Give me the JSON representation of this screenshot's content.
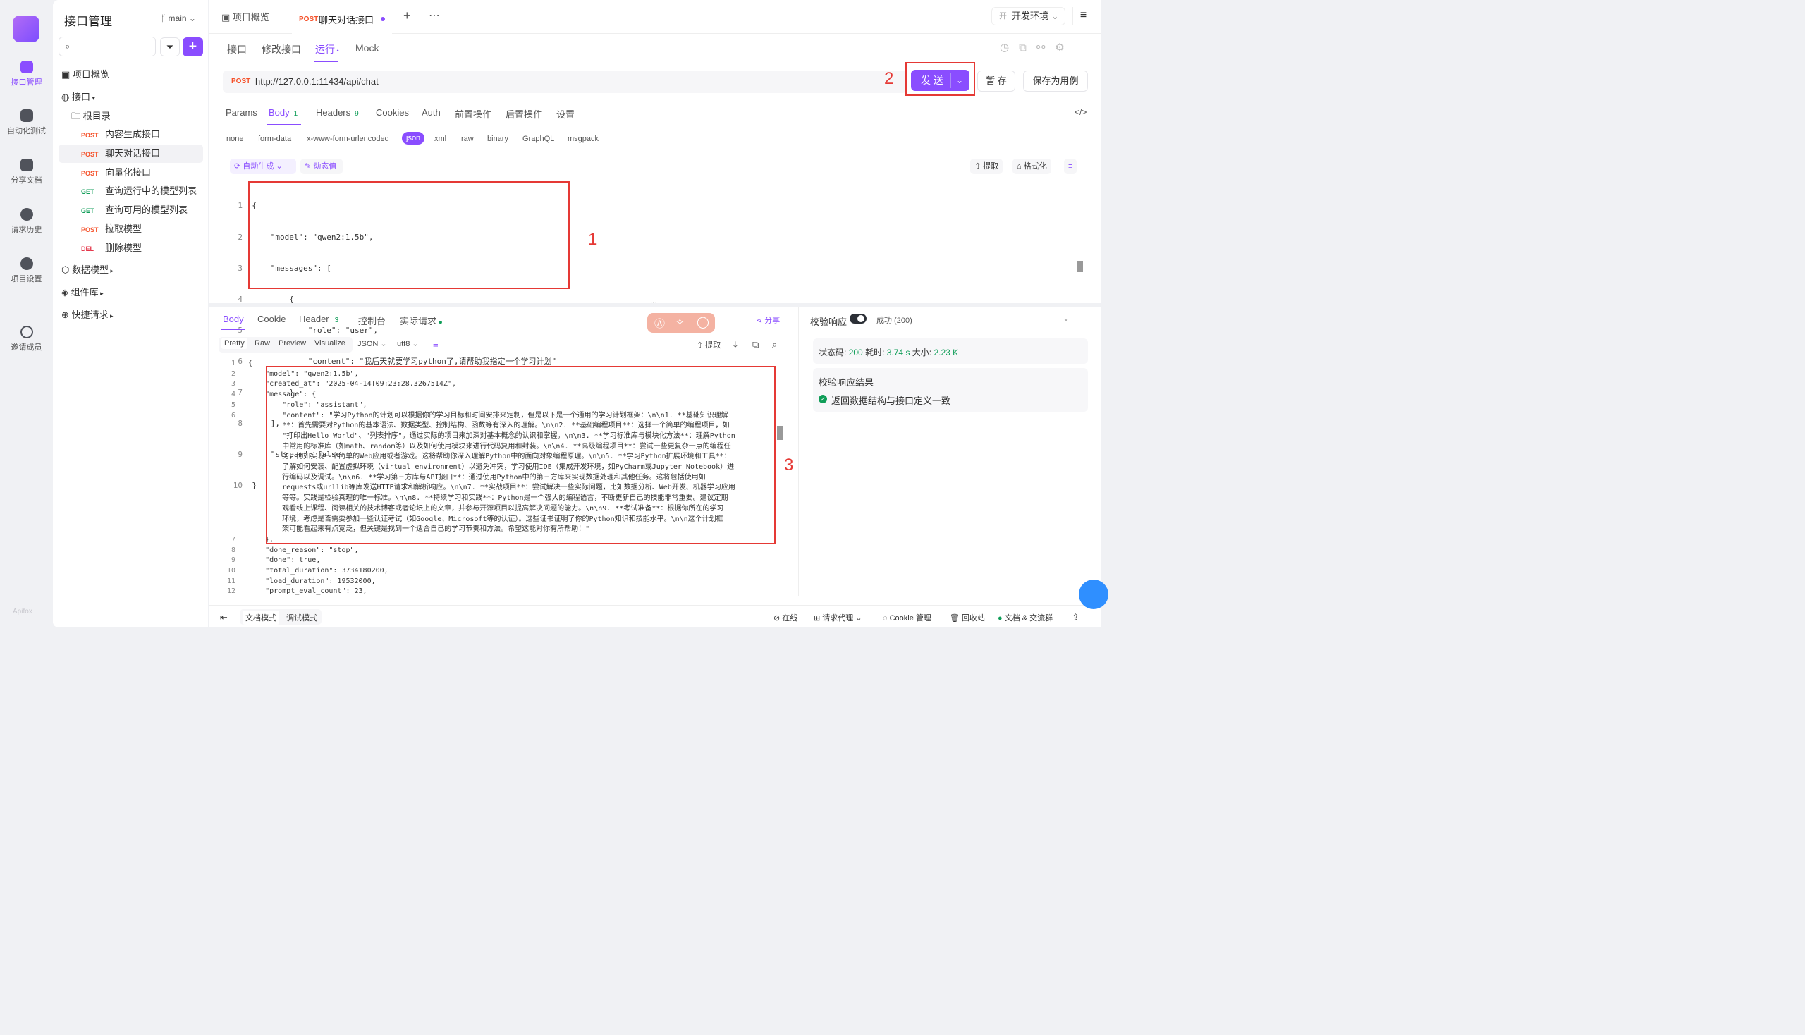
{
  "rail": {
    "items": [
      {
        "label": "接口管理",
        "icon": "api-icon"
      },
      {
        "label": "自动化测试",
        "icon": "automation-icon"
      },
      {
        "label": "分享文档",
        "icon": "book-icon"
      },
      {
        "label": "请求历史",
        "icon": "clock-icon"
      },
      {
        "label": "项目设置",
        "icon": "gear-icon"
      },
      {
        "label": "邀请成员",
        "icon": "invite-user-icon"
      }
    ],
    "brand": "Apifox"
  },
  "tree": {
    "title": "接口管理",
    "branch": "main",
    "overview": "项目概览",
    "api_group": "接口",
    "root": "根目录",
    "endpoints": [
      {
        "method": "POST",
        "name": "内容生成接口"
      },
      {
        "method": "POST",
        "name": "聊天对话接口"
      },
      {
        "method": "POST",
        "name": "向量化接口"
      },
      {
        "method": "GET",
        "name": "查询运行中的模型列表"
      },
      {
        "method": "GET",
        "name": "查询可用的模型列表"
      },
      {
        "method": "POST",
        "name": "拉取模型"
      },
      {
        "method": "DEL",
        "name": "删除模型"
      }
    ],
    "groups": [
      "数据模型",
      "组件库",
      "快捷请求"
    ]
  },
  "tabs": {
    "overview": "项目概览",
    "active_method": "POST",
    "active": "聊天对话接口",
    "env": "开发环境",
    "env_badge": "开"
  },
  "subtabs": [
    "接口",
    "修改接口",
    "运行",
    "Mock"
  ],
  "request": {
    "method": "POST",
    "url": "http://127.0.0.1:11434/api/chat",
    "send": "发 送",
    "save": "暂 存",
    "save_case": "保存为用例"
  },
  "param_tabs": {
    "items": [
      "Params",
      "Body",
      "Headers",
      "Cookies",
      "Auth",
      "前置操作",
      "后置操作",
      "设置"
    ],
    "body_count": "1",
    "headers_count": "9"
  },
  "body_types": [
    "none",
    "form-data",
    "x-www-form-urlencoded",
    "json",
    "xml",
    "raw",
    "binary",
    "GraphQL",
    "msgpack"
  ],
  "body_tools": {
    "auto": "自动生成",
    "dynamic": "动态值",
    "extract": "提取",
    "format": "格式化"
  },
  "body_code": [
    "{",
    "    \"model\": \"qwen2:1.5b\",",
    "    \"messages\": [",
    "        {",
    "            \"role\": \"user\",",
    "            \"content\": \"我后天就要学习python了,请帮助我指定一个学习计划\"",
    "        }",
    "    ],",
    "    \"stream\": false",
    "}"
  ],
  "labels": {
    "one": "1",
    "two": "2",
    "three": "3"
  },
  "response": {
    "tabs": [
      "Body",
      "Cookie",
      "Header",
      "控制台",
      "实际请求"
    ],
    "header_count": "3",
    "share": "分享",
    "formats": [
      "Pretty",
      "Raw",
      "Preview",
      "Visualize"
    ],
    "lang": "JSON",
    "encoding": "utf8",
    "extract": "提取",
    "lines": [
      {
        "n": "1",
        "t": "{"
      },
      {
        "n": "2",
        "t": "    \"model\": \"qwen2:1.5b\","
      },
      {
        "n": "3",
        "t": "    \"created_at\": \"2025-04-14T09:23:28.3267514Z\","
      },
      {
        "n": "4",
        "t": "    \"message\": {"
      },
      {
        "n": "5",
        "t": "        \"role\": \"assistant\","
      },
      {
        "n": "6",
        "t": "        \"content\": \"学习Python的计划可以根据你的学习目标和时间安排来定制，但是以下是一个通用的学习计划框架：\\n\\n1. **基础知识理解"
      },
      {
        "n": "",
        "t": "        **：首先需要对Python的基本语法、数据类型、控制结构、函数等有深入的理解。\\n\\n2. **基础编程项目**：选择一个简单的编程项目，如"
      },
      {
        "n": "",
        "t": "        \"打印出Hello World\"、\"列表排序\"。通过实际的项目来加深对基本概念的认识和掌握。\\n\\n3. **学习标准库与模块化方法**：理解Python"
      },
      {
        "n": "",
        "t": "        中常用的标准库（如math、random等）以及如何使用模块来进行代码复用和封装。\\n\\n4. **高级编程项目**：尝试一些更复杂一点的编程任"
      },
      {
        "n": "",
        "t": "        务，比如实现一个简单的Web应用或者游戏。这将帮助你深入理解Python中的面向对象编程原理。\\n\\n5. **学习Python扩展环境和工具**："
      },
      {
        "n": "",
        "t": "        了解如何安装、配置虚拟环境（virtual environment）以避免冲突，学习使用IDE（集成开发环境，如PyCharm或Jupyter Notebook）进"
      },
      {
        "n": "",
        "t": "        行编码以及调试。\\n\\n6. **学习第三方库与API接口**：通过使用Python中的第三方库来实现数据处理和其他任务。这将包括使用如"
      },
      {
        "n": "",
        "t": "        requests或urllib等库发送HTTP请求和解析响应。\\n\\n7. **实战项目**：尝试解决一些实际问题，比如数据分析、Web开发、机器学习应用"
      },
      {
        "n": "",
        "t": "        等等。实践是检验真理的唯一标准。\\n\\n8. **持续学习和实践**：Python是一个强大的编程语言，不断更新自己的技能非常重要。建议定期"
      },
      {
        "n": "",
        "t": "        观看线上课程、阅读相关的技术博客或者论坛上的文章，并参与开源项目以提高解决问题的能力。\\n\\n9. **考试准备**：根据你所在的学习"
      },
      {
        "n": "",
        "t": "        环境，考虑是否需要参加一些认证考试（如Google、Microsoft等的认证）。这些证书证明了你的Python知识和技能水平。\\n\\n这个计划框"
      },
      {
        "n": "",
        "t": "        架可能看起来有点宽泛，但关键是找到一个适合自己的学习节奏和方法。希望这能对你有所帮助！\""
      },
      {
        "n": "7",
        "t": "    },"
      },
      {
        "n": "8",
        "t": "    \"done_reason\": \"stop\","
      },
      {
        "n": "9",
        "t": "    \"done\": true,"
      },
      {
        "n": "10",
        "t": "    \"total_duration\": 3734180200,"
      },
      {
        "n": "11",
        "t": "    \"load_duration\": 19532000,"
      },
      {
        "n": "12",
        "t": "    \"prompt_eval_count\": 23,"
      }
    ]
  },
  "validate": {
    "label": "校验响应",
    "result": "成功 (200)",
    "status_label": "状态码:",
    "status": "200",
    "time_label": "耗时:",
    "time": "3.74 s",
    "size_label": "大小:",
    "size": "2.23 K",
    "title": "校验响应结果",
    "message": "返回数据结构与接口定义一致"
  },
  "footer": {
    "doc_mode": "文档模式",
    "debug_mode": "调试模式",
    "online": "在线",
    "proxy": "请求代理",
    "cookie": "Cookie 管理",
    "recycle": "回收站",
    "docs": "文档 & 交流群"
  },
  "colors": {
    "accent": "#8a4dff",
    "post": "#f5522b",
    "get": "#0f9d58",
    "highlight": "#e53935"
  }
}
